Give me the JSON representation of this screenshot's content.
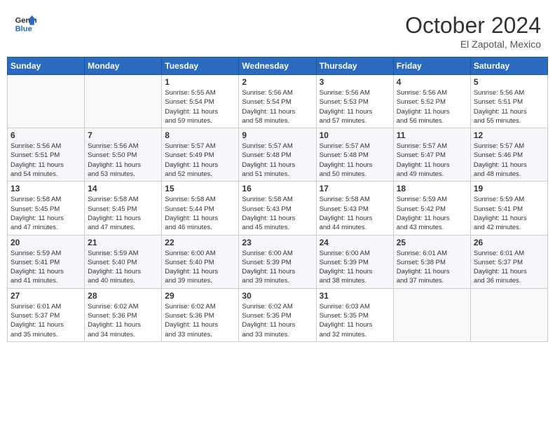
{
  "header": {
    "logo_line1": "General",
    "logo_line2": "Blue",
    "month": "October 2024",
    "location": "El Zapotal, Mexico"
  },
  "weekdays": [
    "Sunday",
    "Monday",
    "Tuesday",
    "Wednesday",
    "Thursday",
    "Friday",
    "Saturday"
  ],
  "weeks": [
    [
      {
        "day": "",
        "info": ""
      },
      {
        "day": "",
        "info": ""
      },
      {
        "day": "1",
        "info": "Sunrise: 5:55 AM\nSunset: 5:54 PM\nDaylight: 11 hours\nand 59 minutes."
      },
      {
        "day": "2",
        "info": "Sunrise: 5:56 AM\nSunset: 5:54 PM\nDaylight: 11 hours\nand 58 minutes."
      },
      {
        "day": "3",
        "info": "Sunrise: 5:56 AM\nSunset: 5:53 PM\nDaylight: 11 hours\nand 57 minutes."
      },
      {
        "day": "4",
        "info": "Sunrise: 5:56 AM\nSunset: 5:52 PM\nDaylight: 11 hours\nand 56 minutes."
      },
      {
        "day": "5",
        "info": "Sunrise: 5:56 AM\nSunset: 5:51 PM\nDaylight: 11 hours\nand 55 minutes."
      }
    ],
    [
      {
        "day": "6",
        "info": "Sunrise: 5:56 AM\nSunset: 5:51 PM\nDaylight: 11 hours\nand 54 minutes."
      },
      {
        "day": "7",
        "info": "Sunrise: 5:56 AM\nSunset: 5:50 PM\nDaylight: 11 hours\nand 53 minutes."
      },
      {
        "day": "8",
        "info": "Sunrise: 5:57 AM\nSunset: 5:49 PM\nDaylight: 11 hours\nand 52 minutes."
      },
      {
        "day": "9",
        "info": "Sunrise: 5:57 AM\nSunset: 5:48 PM\nDaylight: 11 hours\nand 51 minutes."
      },
      {
        "day": "10",
        "info": "Sunrise: 5:57 AM\nSunset: 5:48 PM\nDaylight: 11 hours\nand 50 minutes."
      },
      {
        "day": "11",
        "info": "Sunrise: 5:57 AM\nSunset: 5:47 PM\nDaylight: 11 hours\nand 49 minutes."
      },
      {
        "day": "12",
        "info": "Sunrise: 5:57 AM\nSunset: 5:46 PM\nDaylight: 11 hours\nand 48 minutes."
      }
    ],
    [
      {
        "day": "13",
        "info": "Sunrise: 5:58 AM\nSunset: 5:45 PM\nDaylight: 11 hours\nand 47 minutes."
      },
      {
        "day": "14",
        "info": "Sunrise: 5:58 AM\nSunset: 5:45 PM\nDaylight: 11 hours\nand 47 minutes."
      },
      {
        "day": "15",
        "info": "Sunrise: 5:58 AM\nSunset: 5:44 PM\nDaylight: 11 hours\nand 46 minutes."
      },
      {
        "day": "16",
        "info": "Sunrise: 5:58 AM\nSunset: 5:43 PM\nDaylight: 11 hours\nand 45 minutes."
      },
      {
        "day": "17",
        "info": "Sunrise: 5:58 AM\nSunset: 5:43 PM\nDaylight: 11 hours\nand 44 minutes."
      },
      {
        "day": "18",
        "info": "Sunrise: 5:59 AM\nSunset: 5:42 PM\nDaylight: 11 hours\nand 43 minutes."
      },
      {
        "day": "19",
        "info": "Sunrise: 5:59 AM\nSunset: 5:41 PM\nDaylight: 11 hours\nand 42 minutes."
      }
    ],
    [
      {
        "day": "20",
        "info": "Sunrise: 5:59 AM\nSunset: 5:41 PM\nDaylight: 11 hours\nand 41 minutes."
      },
      {
        "day": "21",
        "info": "Sunrise: 5:59 AM\nSunset: 5:40 PM\nDaylight: 11 hours\nand 40 minutes."
      },
      {
        "day": "22",
        "info": "Sunrise: 6:00 AM\nSunset: 5:40 PM\nDaylight: 11 hours\nand 39 minutes."
      },
      {
        "day": "23",
        "info": "Sunrise: 6:00 AM\nSunset: 5:39 PM\nDaylight: 11 hours\nand 39 minutes."
      },
      {
        "day": "24",
        "info": "Sunrise: 6:00 AM\nSunset: 5:39 PM\nDaylight: 11 hours\nand 38 minutes."
      },
      {
        "day": "25",
        "info": "Sunrise: 6:01 AM\nSunset: 5:38 PM\nDaylight: 11 hours\nand 37 minutes."
      },
      {
        "day": "26",
        "info": "Sunrise: 6:01 AM\nSunset: 5:37 PM\nDaylight: 11 hours\nand 36 minutes."
      }
    ],
    [
      {
        "day": "27",
        "info": "Sunrise: 6:01 AM\nSunset: 5:37 PM\nDaylight: 11 hours\nand 35 minutes."
      },
      {
        "day": "28",
        "info": "Sunrise: 6:02 AM\nSunset: 5:36 PM\nDaylight: 11 hours\nand 34 minutes."
      },
      {
        "day": "29",
        "info": "Sunrise: 6:02 AM\nSunset: 5:36 PM\nDaylight: 11 hours\nand 33 minutes."
      },
      {
        "day": "30",
        "info": "Sunrise: 6:02 AM\nSunset: 5:35 PM\nDaylight: 11 hours\nand 33 minutes."
      },
      {
        "day": "31",
        "info": "Sunrise: 6:03 AM\nSunset: 5:35 PM\nDaylight: 11 hours\nand 32 minutes."
      },
      {
        "day": "",
        "info": ""
      },
      {
        "day": "",
        "info": ""
      }
    ]
  ]
}
